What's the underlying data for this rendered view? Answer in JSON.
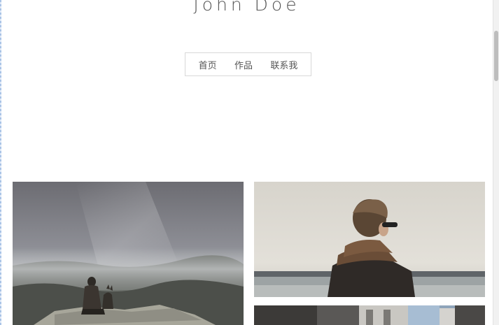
{
  "site": {
    "title": "John Doe"
  },
  "nav": {
    "items": [
      {
        "label": "首页"
      },
      {
        "label": "作品"
      },
      {
        "label": "联系我"
      }
    ]
  },
  "gallery": {
    "photos": [
      {
        "subject": "person sitting on foggy mountain cliff"
      },
      {
        "subject": "person in jacket with sunglasses facing the sea"
      },
      {
        "subject": "city street with buildings"
      }
    ]
  },
  "colors": {
    "text": "#555555",
    "nav_border": "#d8d8d8",
    "background": "#ffffff"
  }
}
